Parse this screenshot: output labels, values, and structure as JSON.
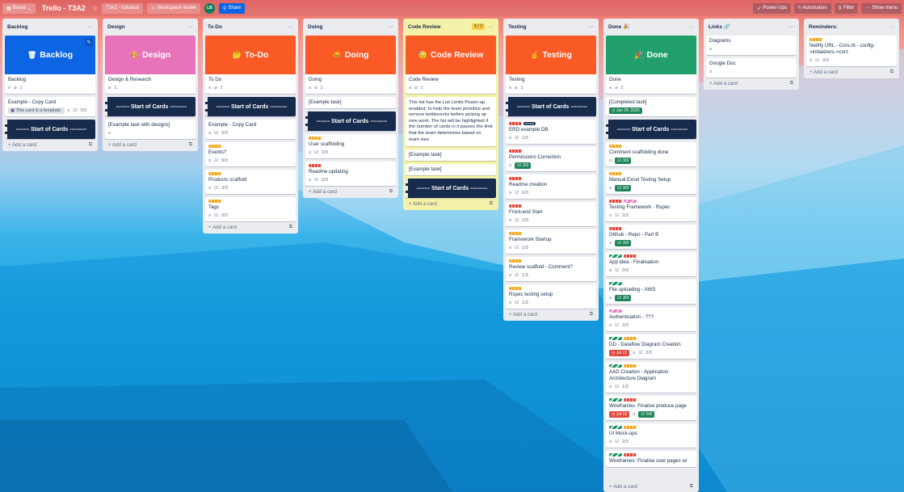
{
  "topbar": {
    "board_view": "Board",
    "board_title": "Trello - T3A2",
    "team": "T3A2 - fullstack",
    "visibility": "Workspace visible",
    "avatar_initials": "LB",
    "share": "Share",
    "powerups": "Power-Ups",
    "automation": "Automation",
    "filter": "Filter",
    "show_menu": "Show menu"
  },
  "common": {
    "add_card": "+ Add a card",
    "menu": "···",
    "separator": "------- Start of Cards ---------"
  },
  "lists": {
    "backlog": {
      "title": "Backlog",
      "cover": {
        "text": "Backlog",
        "icon": "🗑",
        "color": "#0c66e4"
      },
      "cover_card": {
        "title": "Backlog",
        "attachments": "1"
      },
      "card1": {
        "title": "Example - Copy Card",
        "template_badge": "This card is a template.",
        "checklist": "0/3"
      }
    },
    "design": {
      "title": "Design",
      "cover": {
        "text": "Design",
        "icon": "🎨",
        "color": "#e774bb"
      },
      "cover_card": {
        "title": "Design & Research",
        "attachments": "1"
      },
      "card1": {
        "title": "[Example task with designs]"
      }
    },
    "todo": {
      "title": "To Do",
      "cover": {
        "text": "To-Do",
        "icon": "🤔",
        "color": "#fa5a26"
      },
      "cover_card": {
        "title": "To Do",
        "attachments": "1"
      },
      "cards": [
        {
          "title": "Example - Copy Card",
          "checklist": "0/3"
        },
        {
          "title": "Events?",
          "checklist": "0/3"
        },
        {
          "title": "Products scaffold",
          "checklist": "3/3"
        },
        {
          "title": "Tags",
          "checklist": "0/3"
        }
      ]
    },
    "doing": {
      "title": "Doing",
      "cover": {
        "text": "Doing",
        "icon": "😡",
        "color": "#fa5a26"
      },
      "cover_card": {
        "title": "Doing",
        "attachments": "1"
      },
      "cards": [
        {
          "title": "[Example task]"
        },
        {
          "title": "User scaffolding",
          "checklist": "3/3"
        },
        {
          "title": "Readme updating",
          "checklist": "0/3"
        }
      ]
    },
    "review": {
      "title": "Code Review",
      "limit": "5 / 3",
      "cover": {
        "text": "Code Review",
        "icon": "😓",
        "color": "#fa5a26"
      },
      "cover_card": {
        "title": "Code Review",
        "attachments": "1"
      },
      "note": "This list has the List Limits Power-up enabled, to help the team prioritize and remove bottlenecks before picking up new work. The list will be highlighted if the number of cards in it passes the limit that the team determines based on team size.",
      "cards": [
        {
          "title": "[Example task]"
        },
        {
          "title": "[Example task]"
        }
      ]
    },
    "testing": {
      "title": "Testing",
      "cover": {
        "text": "Testing",
        "icon": "☝",
        "color": "#fa5a26"
      },
      "cover_card": {
        "title": "Testing",
        "attachments": "1"
      },
      "cards": [
        {
          "title": "ERD example DB",
          "checklist": "1/3",
          "label_text": "nunun"
        },
        {
          "title": "Permissions Correction",
          "checklist": "3/3"
        },
        {
          "title": "Readme creation",
          "checklist": "0/3"
        },
        {
          "title": "Front-end Start",
          "checklist": "2/3"
        },
        {
          "title": "Framework Startup",
          "checklist": "1/3"
        },
        {
          "title": "Review scaffold - Comment?",
          "checklist": "1/3"
        },
        {
          "title": "Rspec testing setup",
          "checklist": "1/3"
        }
      ]
    },
    "done": {
      "title": "Done 🎉",
      "cover": {
        "text": "Done",
        "icon": "🎉",
        "color": "#22a06b"
      },
      "cover_card": {
        "title": "Done",
        "attachments": "2"
      },
      "completed": {
        "title": "[Completed task]",
        "date": "Jan 24, 2020"
      },
      "cards": [
        {
          "title": "Comment scaffolding done",
          "checklist": "3/3"
        },
        {
          "title": "Manual Excel Testing Setup",
          "checklist": "3/3"
        },
        {
          "title": "Testing Framework - Rspec",
          "checklist": "2/3"
        },
        {
          "title": "Github - Repo - Part B",
          "checklist": "3/3"
        },
        {
          "title": "App idea - Finalisation",
          "checklist": "0/3"
        },
        {
          "title": "File uploading - AWS",
          "checklist": "3/3"
        },
        {
          "title": "Authentication - ???",
          "checklist": "2/3"
        },
        {
          "title": "DD - Dataflow Diagram Creation",
          "date": "Jul 12",
          "checklist": "2/3"
        },
        {
          "title": "AAD Creation - Application Architecture Diagram",
          "checklist": "1/3"
        },
        {
          "title": "Wireframes: Finalise produce page",
          "date": "Jul 15",
          "checklist": "6/6"
        },
        {
          "title": "UI Mock-ups",
          "checklist": "2/3"
        },
        {
          "title": "Wireframes: Finalise user pages w/"
        }
      ]
    },
    "links": {
      "title": "Links 🔗",
      "cards": [
        {
          "title": "Diagrams"
        },
        {
          "title": "Google Doc"
        }
      ]
    },
    "reminders": {
      "title": "Reminders:",
      "cards": [
        {
          "title": "Netlify URL - Cors.rb - config->initializers->corz",
          "checklist": "0/3"
        }
      ]
    }
  }
}
